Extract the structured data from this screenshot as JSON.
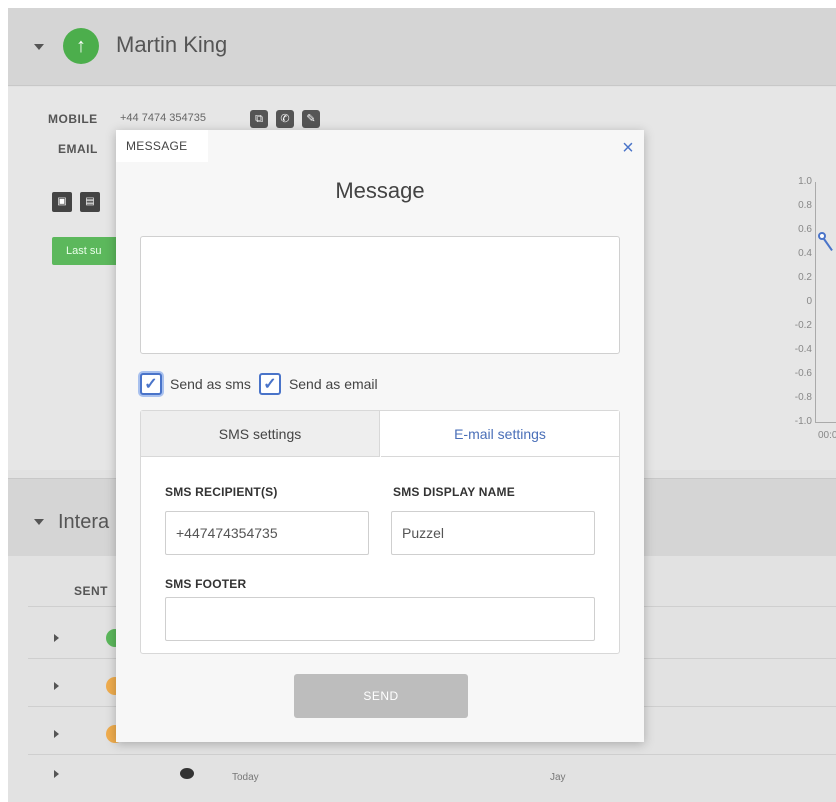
{
  "contact": {
    "avatar_icon": "arrow-up-icon",
    "avatar_glyph": "↑",
    "name": "Martin King",
    "mobile_label": "MOBILE",
    "mobile_number": "+44 7474 354735",
    "email_label": "EMAIL",
    "status_badge": "Last su"
  },
  "chart": {
    "y_ticks": [
      "1.0",
      "0.8",
      "0.6",
      "0.4",
      "0.2",
      "0",
      "-0.2",
      "-0.4",
      "-0.6",
      "-0.8",
      "-1.0"
    ],
    "x_tick": "00:0"
  },
  "interactions": {
    "title": "Intera",
    "col_sent": "SENT",
    "rows": [
      {
        "dot_color": "#5cb85c"
      },
      {
        "dot_color": "#f0ad4e"
      },
      {
        "dot_color": "#f0ad4e"
      }
    ],
    "last_row": {
      "date": "Today",
      "agent": "Jay"
    }
  },
  "modal": {
    "tab_label": "MESSAGE",
    "close_glyph": "×",
    "title": "Message",
    "message_value": "",
    "send_as_sms_label": "Send as sms",
    "send_as_sms_checked": true,
    "send_as_email_label": "Send as email",
    "send_as_email_checked": true,
    "tabs": {
      "sms_settings": "SMS settings",
      "email_settings": "E-mail settings"
    },
    "sms_recipient_label": "SMS RECIPIENT(S)",
    "sms_recipient_value": "+447474354735",
    "sms_display_name_label": "SMS DISPLAY NAME",
    "sms_display_name_value": "Puzzel",
    "sms_footer_label": "SMS FOOTER",
    "sms_footer_value": "",
    "send_label": "SEND"
  },
  "colors": {
    "accent": "#4a74c9",
    "green": "#5cb85c",
    "orange": "#f0ad4e",
    "send_disabled": "#bdbdbd"
  }
}
